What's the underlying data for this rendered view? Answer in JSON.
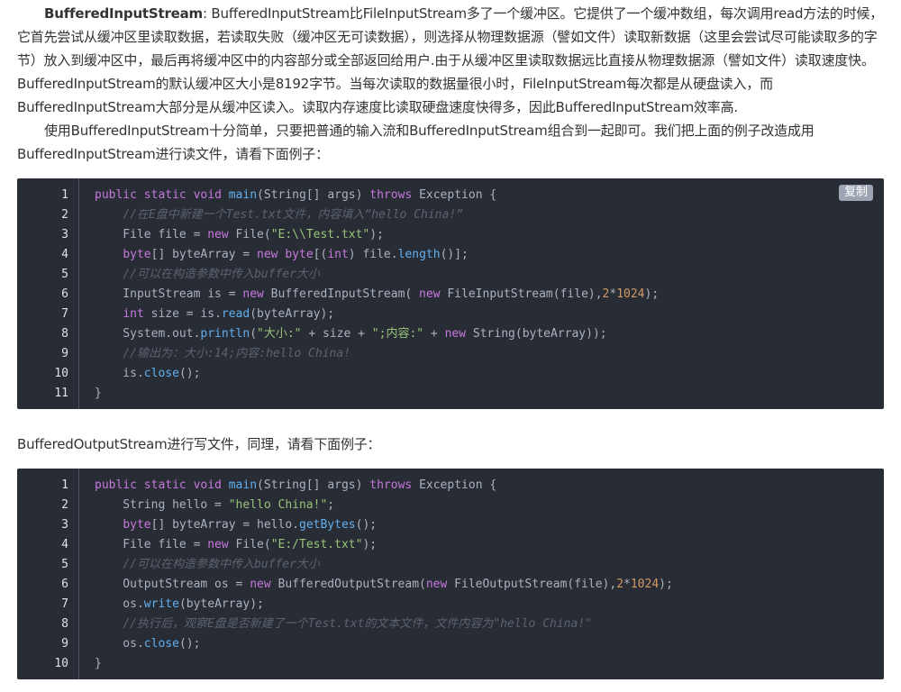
{
  "article": {
    "intro": {
      "term": "BufferedInputStream",
      "para1_rest": ": BufferedInputStream比FileInputStream多了一个缓冲区。它提供了一个缓冲数组，每次调用read方法的时候，它首先尝试从缓冲区里读取数据，若读取失败（缓冲区无可读数据），则选择从物理数据源（譬如文件）读取新数据（这里会尝试尽可能读取多的字节）放入到缓冲区中，最后再将缓冲区中的内容部分或全部返回给用户.由于从缓冲区里读取数据远比直接从物理数据源（譬如文件）读取速度快。BufferedInputStream的默认缓冲区大小是8192字节。当每次读取的数据量很小时，FileInputStream每次都是从硬盘读入，而BufferedInputStream大部分是从缓冲区读入。读取内存速度比读取硬盘速度快得多，因此BufferedInputStream效率高.",
      "para2": "使用BufferedInputStream十分简单，只要把普通的输入流和BufferedInputStream组合到一起即可。我们把上面的例子改造成用BufferedInputStream进行读文件，请看下面例子："
    },
    "intro2": "BufferedOutputStream进行写文件，同理，请看下面例子：",
    "copy_label": "复制",
    "code_blocks": [
      {
        "lines": [
          {
            "n": "1",
            "t": [
              [
                "kw",
                "public"
              ],
              [
                "pl",
                " "
              ],
              [
                "kw",
                "static"
              ],
              [
                "pl",
                " "
              ],
              [
                "kw",
                "void"
              ],
              [
                "pl",
                " "
              ],
              [
                "fn",
                "main"
              ],
              [
                "pl",
                "(String[] args) "
              ],
              [
                "kw",
                "throws"
              ],
              [
                "pl",
                " Exception {"
              ]
            ]
          },
          {
            "n": "2",
            "t": [
              [
                "pl",
                "    "
              ],
              [
                "cm",
                "//在E盘中新建一个Test.txt文件，内容填入“hello China!”"
              ]
            ]
          },
          {
            "n": "3",
            "t": [
              [
                "pl",
                "    File file = "
              ],
              [
                "kw",
                "new"
              ],
              [
                "pl",
                " File("
              ],
              [
                "str",
                "\"E:\\\\Test.txt\""
              ],
              [
                "pl",
                ");"
              ]
            ]
          },
          {
            "n": "4",
            "t": [
              [
                "pl",
                "    "
              ],
              [
                "kw",
                "byte"
              ],
              [
                "pl",
                "[] byteArray = "
              ],
              [
                "kw",
                "new"
              ],
              [
                "pl",
                " "
              ],
              [
                "kw",
                "byte"
              ],
              [
                "pl",
                "[("
              ],
              [
                "kw",
                "int"
              ],
              [
                "pl",
                ") file."
              ],
              [
                "fn",
                "length"
              ],
              [
                "pl",
                "()];"
              ]
            ]
          },
          {
            "n": "5",
            "t": [
              [
                "pl",
                "    "
              ],
              [
                "cm",
                "//可以在构造参数中传入buffer大小"
              ]
            ]
          },
          {
            "n": "6",
            "t": [
              [
                "pl",
                "    InputStream is = "
              ],
              [
                "kw",
                "new"
              ],
              [
                "pl",
                " BufferedInputStream( "
              ],
              [
                "kw",
                "new"
              ],
              [
                "pl",
                " FileInputStream(file),"
              ],
              [
                "num",
                "2"
              ],
              [
                "pl",
                "*"
              ],
              [
                "num",
                "1024"
              ],
              [
                "pl",
                ");"
              ]
            ]
          },
          {
            "n": "7",
            "t": [
              [
                "pl",
                "    "
              ],
              [
                "kw",
                "int"
              ],
              [
                "pl",
                " size = is."
              ],
              [
                "fn",
                "read"
              ],
              [
                "pl",
                "(byteArray);"
              ]
            ]
          },
          {
            "n": "8",
            "t": [
              [
                "pl",
                "    System.out."
              ],
              [
                "fn",
                "println"
              ],
              [
                "pl",
                "("
              ],
              [
                "str",
                "\"大小:\""
              ],
              [
                "pl",
                " + size + "
              ],
              [
                "str",
                "\";内容:\""
              ],
              [
                "pl",
                " + "
              ],
              [
                "kw",
                "new"
              ],
              [
                "pl",
                " String(byteArray));"
              ]
            ]
          },
          {
            "n": "9",
            "t": [
              [
                "pl",
                "    "
              ],
              [
                "cm",
                "//输出为：大小:14;内容:hello China!"
              ]
            ]
          },
          {
            "n": "10",
            "t": [
              [
                "pl",
                "    is."
              ],
              [
                "fn",
                "close"
              ],
              [
                "pl",
                "();"
              ]
            ]
          },
          {
            "n": "11",
            "t": [
              [
                "pl",
                "}"
              ]
            ]
          }
        ]
      },
      {
        "lines": [
          {
            "n": "1",
            "t": [
              [
                "kw",
                "public"
              ],
              [
                "pl",
                " "
              ],
              [
                "kw",
                "static"
              ],
              [
                "pl",
                " "
              ],
              [
                "kw",
                "void"
              ],
              [
                "pl",
                " "
              ],
              [
                "fn",
                "main"
              ],
              [
                "pl",
                "(String[] args) "
              ],
              [
                "kw",
                "throws"
              ],
              [
                "pl",
                " Exception {"
              ]
            ]
          },
          {
            "n": "2",
            "t": [
              [
                "pl",
                "    String hello = "
              ],
              [
                "str",
                "\"hello China!\""
              ],
              [
                "pl",
                ";"
              ]
            ]
          },
          {
            "n": "3",
            "t": [
              [
                "pl",
                "    "
              ],
              [
                "kw",
                "byte"
              ],
              [
                "pl",
                "[] byteArray = hello."
              ],
              [
                "fn",
                "getBytes"
              ],
              [
                "pl",
                "();"
              ]
            ]
          },
          {
            "n": "4",
            "t": [
              [
                "pl",
                "    File file = "
              ],
              [
                "kw",
                "new"
              ],
              [
                "pl",
                " File("
              ],
              [
                "str",
                "\"E:/Test.txt\""
              ],
              [
                "pl",
                ");"
              ]
            ]
          },
          {
            "n": "5",
            "t": [
              [
                "pl",
                "    "
              ],
              [
                "cm",
                "//可以在构造参数中传入buffer大小"
              ]
            ]
          },
          {
            "n": "6",
            "t": [
              [
                "pl",
                "    OutputStream os = "
              ],
              [
                "kw",
                "new"
              ],
              [
                "pl",
                " BufferedOutputStream("
              ],
              [
                "kw",
                "new"
              ],
              [
                "pl",
                " FileOutputStream(file),"
              ],
              [
                "num",
                "2"
              ],
              [
                "pl",
                "*"
              ],
              [
                "num",
                "1024"
              ],
              [
                "pl",
                ");"
              ]
            ]
          },
          {
            "n": "7",
            "t": [
              [
                "pl",
                "    os."
              ],
              [
                "fn",
                "write"
              ],
              [
                "pl",
                "(byteArray);"
              ]
            ]
          },
          {
            "n": "8",
            "t": [
              [
                "pl",
                "    "
              ],
              [
                "cm",
                "//执行后，观察E盘是否新建了一个Test.txt的文本文件，文件内容为\"hello China!\""
              ]
            ]
          },
          {
            "n": "9",
            "t": [
              [
                "pl",
                "    os."
              ],
              [
                "fn",
                "close"
              ],
              [
                "pl",
                "();"
              ]
            ]
          },
          {
            "n": "10",
            "t": [
              [
                "pl",
                "}"
              ]
            ]
          }
        ]
      }
    ],
    "colors": {
      "code_background": "#282c34",
      "keyword": "#c678dd",
      "function": "#61afef",
      "string": "#98c379",
      "number": "#d19a66",
      "comment": "#5c6370",
      "plain": "#abb2bf"
    }
  }
}
